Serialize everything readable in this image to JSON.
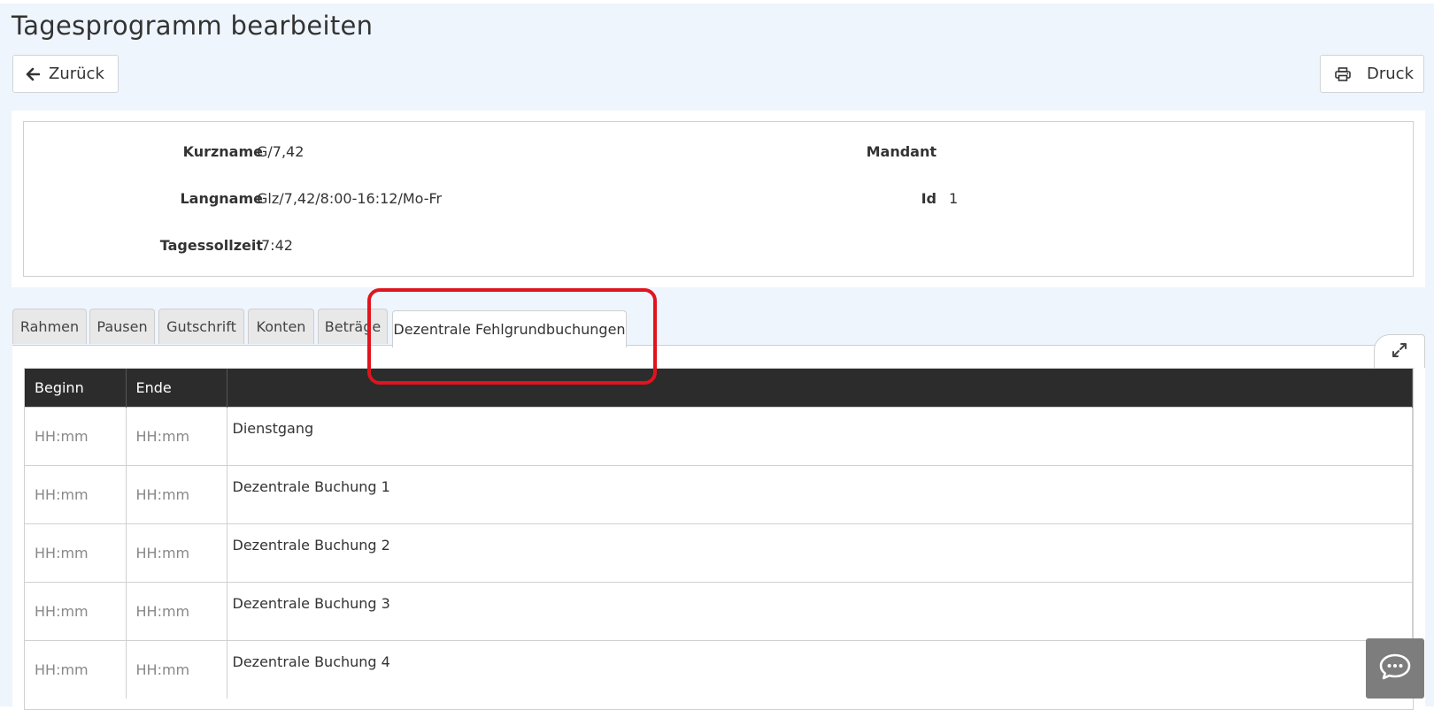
{
  "page": {
    "title": "Tagesprogramm bearbeiten"
  },
  "toolbar": {
    "back_label": "Zurück",
    "print_label": "Druck"
  },
  "header": {
    "kurzname_label": "Kurzname",
    "kurzname_value": "G/7,42",
    "langname_label": "Langname",
    "langname_value": "Glz/7,42/8:00-16:12/Mo-Fr",
    "tagessollzeit_label": "Tagessollzeit",
    "tagessollzeit_value": "7:42",
    "mandant_label": "Mandant",
    "mandant_value": "",
    "id_label": "Id",
    "id_value": "1"
  },
  "tabs": [
    {
      "label": "Rahmen"
    },
    {
      "label": "Pausen"
    },
    {
      "label": "Gutschrift"
    },
    {
      "label": "Konten"
    },
    {
      "label": "Beträge"
    },
    {
      "label": "Dezentrale Fehlgrundbuchungen",
      "active": true
    }
  ],
  "table": {
    "headers": [
      "Beginn",
      "Ende",
      ""
    ],
    "rows": [
      {
        "beginn": "HH:mm",
        "ende": "HH:mm",
        "desc": "Dienstgang"
      },
      {
        "beginn": "HH:mm",
        "ende": "HH:mm",
        "desc": "Dezentrale Buchung 1"
      },
      {
        "beginn": "HH:mm",
        "ende": "HH:mm",
        "desc": "Dezentrale Buchung 2"
      },
      {
        "beginn": "HH:mm",
        "ende": "HH:mm",
        "desc": "Dezentrale Buchung 3"
      },
      {
        "beginn": "HH:mm",
        "ende": "HH:mm",
        "desc": "Dezentrale Buchung 4"
      }
    ]
  },
  "icons": {
    "back": "arrow-left-icon",
    "print": "printer-icon",
    "expand": "expand-icon",
    "chat": "chat-icon"
  },
  "colors": {
    "page_bg": "#eef5fd",
    "table_header_bg": "#2c2c2c",
    "highlight": "#e0141e",
    "chat_button_bg": "#7d7d7d"
  }
}
